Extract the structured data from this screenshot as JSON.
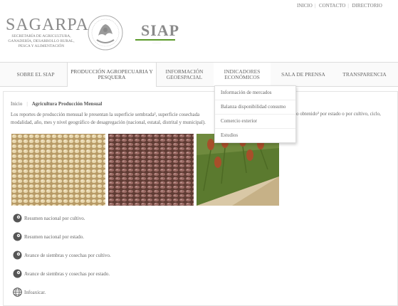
{
  "toplinks": {
    "inicio": "INICIO",
    "contacto": "CONTACTO",
    "directorio": "DIRECTORIO"
  },
  "header": {
    "logo_title": "SAGARPA",
    "logo_subtitle": "SECRETARÍA DE AGRICULTURA, GANADERÍA, DESARROLLO RURAL, PESCA Y ALIMENTACIÓN",
    "siap_title": "SIAP",
    "brand_green": "#5a9a2a"
  },
  "nav": {
    "items": [
      {
        "label": "SOBRE EL SIAP"
      },
      {
        "label": "PRODUCCIÓN AGROPECUARIA Y PESQUERA"
      },
      {
        "label": "INFORMACIÓN GEOESPACIAL"
      },
      {
        "label": "INDICADORES ECONÓMICOS"
      },
      {
        "label": "SALA DE PRENSA"
      },
      {
        "label": "TRANSPARENCIA"
      }
    ]
  },
  "dropdown": {
    "items": [
      "Información de mercados",
      "Balanza disponibilidad consumo",
      "Comercio exterior",
      "Estudios"
    ]
  },
  "breadcrumb": {
    "home": "Inicio",
    "current": "Agricultura Producción Mensual"
  },
  "intro": {
    "line1": "Los reportes de producción mensual le presentan la superficie sembrada², superficie cosechada",
    "line1_right": "o obtenido³ por estado o por cultivo, ciclo,",
    "line2": "modalidad, año, mes y nivel geográfico de desagregación (nacional, estatal, distrital y municipal)."
  },
  "links": [
    {
      "icon": "globe-gear-icon",
      "label": "Resumen nacional por cultivo."
    },
    {
      "icon": "globe-gear-icon",
      "label": "Resumen nacional por estado."
    },
    {
      "icon": "globe-gear-icon",
      "label": "Avance de siembras y cosechas por cultivo."
    },
    {
      "icon": "globe-gear-icon",
      "label": "Avance de siembras y cosechas por estado."
    },
    {
      "icon": "globe-icon",
      "label": "Infoaxicar."
    }
  ]
}
